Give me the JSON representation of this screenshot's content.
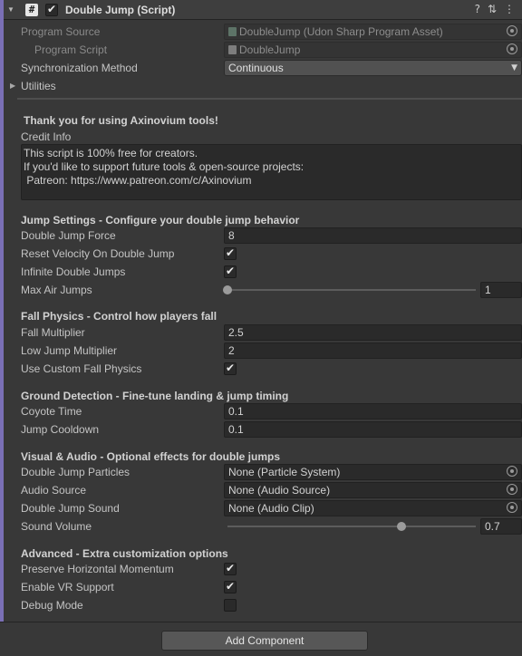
{
  "header": {
    "title": "Double Jump (Script)",
    "enabled_check": "✔",
    "hash_glyph": "#",
    "help_icon": "?",
    "settings_icon": "⇅",
    "menu_icon": "⋮"
  },
  "program": {
    "source_label": "Program Source",
    "source_value": "DoubleJump (Udon Sharp Program Asset)",
    "script_label": "Program Script",
    "script_value": "DoubleJump",
    "sync_label": "Synchronization Method",
    "sync_value": "Continuous",
    "utilities_label": "Utilities"
  },
  "credit": {
    "heading": "Thank you for using Axinovium tools!",
    "label": "Credit Info",
    "line1": "This script is 100% free for creators.",
    "line2": "If you'd like to support future tools & open-source projects:",
    "line3": " Patreon: https://www.patreon.com/c/Axinovium"
  },
  "jump": {
    "heading": "Jump Settings - Configure your double jump behavior",
    "force_label": "Double Jump Force",
    "force_value": "8",
    "reset_label": "Reset Velocity On Double Jump",
    "reset_checked": true,
    "infinite_label": "Infinite Double Jumps",
    "infinite_checked": true,
    "max_air_label": "Max Air Jumps",
    "max_air_value": "1",
    "max_air_fraction": 0.0
  },
  "fall": {
    "heading": "Fall Physics - Control how players fall",
    "fall_mult_label": "Fall Multiplier",
    "fall_mult_value": "2.5",
    "low_jump_label": "Low Jump Multiplier",
    "low_jump_value": "2",
    "custom_label": "Use Custom Fall Physics",
    "custom_checked": true
  },
  "ground": {
    "heading": "Ground Detection - Fine-tune landing & jump timing",
    "coyote_label": "Coyote Time",
    "coyote_value": "0.1",
    "cooldown_label": "Jump Cooldown",
    "cooldown_value": "0.1"
  },
  "visual": {
    "heading": "Visual & Audio - Optional effects for double jumps",
    "particles_label": "Double Jump Particles",
    "particles_value": "None (Particle System)",
    "audio_source_label": "Audio Source",
    "audio_source_value": "None (Audio Source)",
    "sound_label": "Double Jump Sound",
    "sound_value": "None (Audio Clip)",
    "volume_label": "Sound Volume",
    "volume_value": "0.7",
    "volume_fraction": 0.7
  },
  "advanced": {
    "heading": "Advanced - Extra customization options",
    "momentum_label": "Preserve Horizontal Momentum",
    "momentum_checked": true,
    "vr_label": "Enable VR Support",
    "vr_checked": true,
    "debug_label": "Debug Mode",
    "debug_checked": false
  },
  "footer": {
    "add_component": "Add Component"
  },
  "colors": {
    "accent": "#7a6fb5",
    "background": "#383838",
    "field": "#2a2a2a"
  }
}
